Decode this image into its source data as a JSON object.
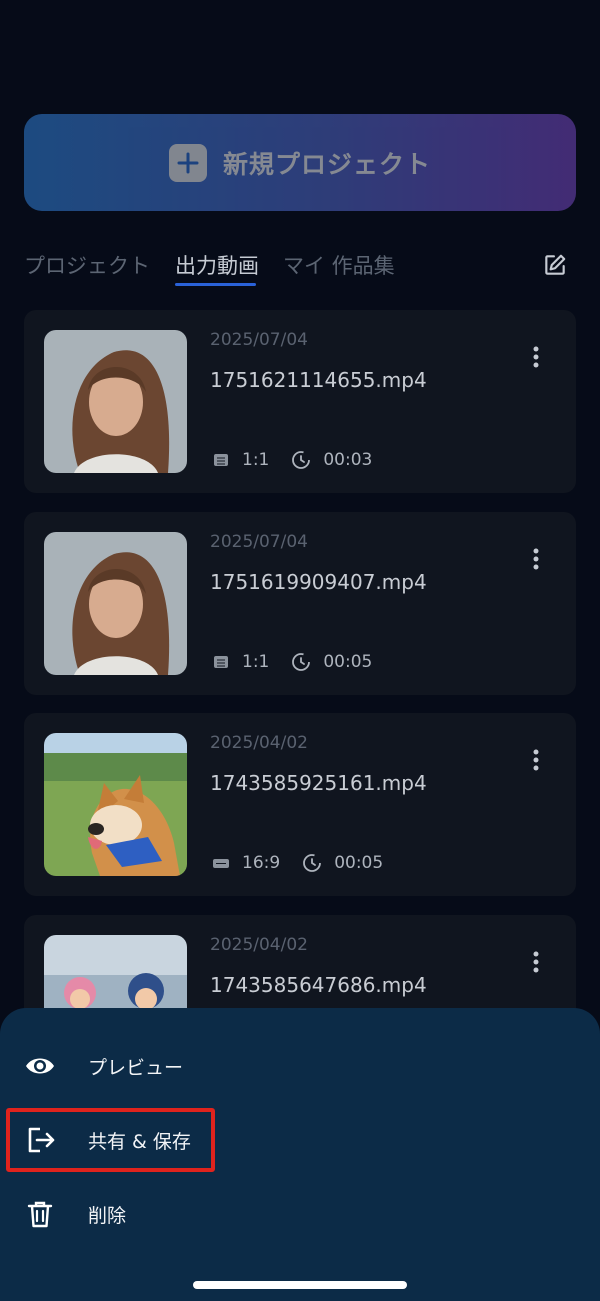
{
  "new_project_button": {
    "label": "新規プロジェクト",
    "icon": "plus-icon"
  },
  "tabs": [
    {
      "label": "プロジェクト",
      "active": false
    },
    {
      "label": "出力動画",
      "active": true
    },
    {
      "label": "マイ 作品集",
      "active": false
    }
  ],
  "videos": [
    {
      "date": "2025/07/04",
      "filename": "1751621114655.mp4",
      "ratio": "1:1",
      "duration": "00:03",
      "thumb": "woman-portrait"
    },
    {
      "date": "2025/07/04",
      "filename": "1751619909407.mp4",
      "ratio": "1:1",
      "duration": "00:05",
      "thumb": "woman-portrait"
    },
    {
      "date": "2025/04/02",
      "filename": "1743585925161.mp4",
      "ratio": "16:9",
      "duration": "00:05",
      "thumb": "shiba-dog"
    },
    {
      "date": "2025/04/02",
      "filename": "1743585647686.mp4",
      "ratio": "",
      "duration": "",
      "thumb": "kids-winter"
    }
  ],
  "action_sheet": {
    "items": [
      {
        "label": "プレビュー",
        "icon": "eye-icon"
      },
      {
        "label": "共有 & 保存",
        "icon": "share-exit-icon"
      },
      {
        "label": "削除",
        "icon": "trash-icon"
      }
    ]
  },
  "colors": {
    "background": "#060b18",
    "card": "#10151f",
    "accent": "#2a62d8",
    "sheet": "#0c2b47",
    "highlight": "#e0231d"
  }
}
